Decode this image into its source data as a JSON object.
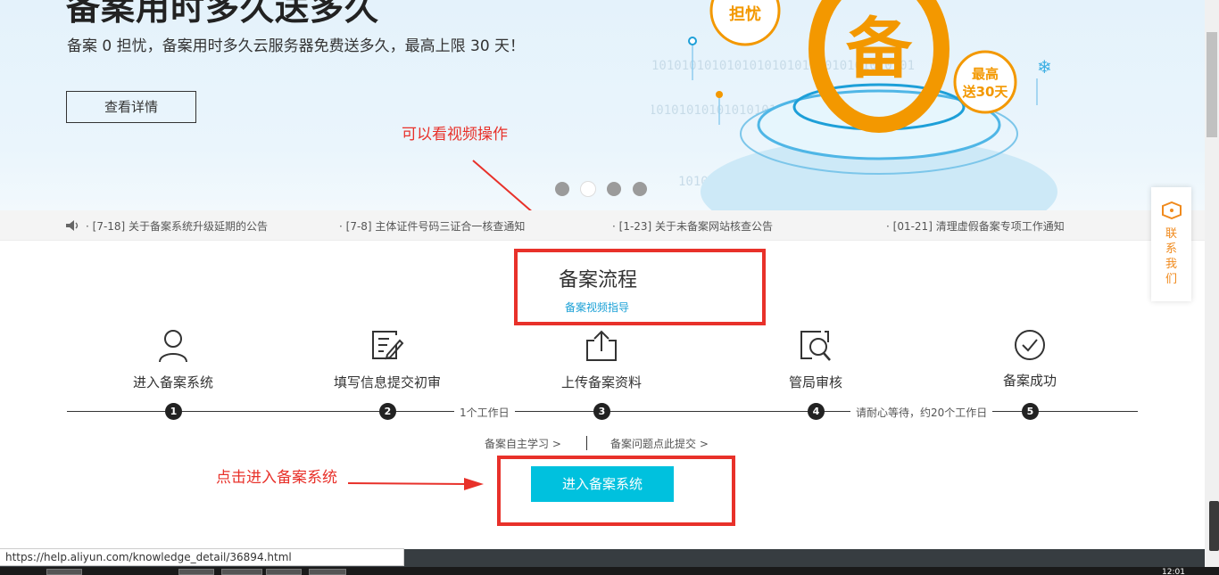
{
  "banner": {
    "title": "备案用时多久送多久",
    "subtitle": "备案 0 担忧，备案用时多久云服务器免费送多久，最高上限 30 天！",
    "detail_button": "查看详情",
    "badge_worry": "担忧",
    "badge_big": "备",
    "badge_max_line1": "最高",
    "badge_max_line2": "送30天",
    "binary_text": "10101010101010101010101010101010101",
    "carousel_active_index": 1,
    "carousel_count": 4
  },
  "annotations": {
    "video_hint": "可以看视频操作",
    "enter_hint": "点击进入备案系统"
  },
  "notices": [
    "[7-18] 关于备案系统升级延期的公告",
    "[7-8] 主体证件号码三证合一核查通知",
    "[1-23] 关于未备案网站核查公告",
    "[01-21] 清理虚假备案专项工作通知"
  ],
  "contact": {
    "label": "联系我们"
  },
  "process": {
    "title": "备案流程",
    "video_link": "备案视频指导",
    "steps": [
      {
        "label": "进入备案系统",
        "num": "1",
        "icon": "user-icon"
      },
      {
        "label": "填写信息提交初审",
        "num": "2",
        "icon": "edit-form-icon"
      },
      {
        "label": "上传备案资料",
        "num": "3",
        "icon": "upload-icon"
      },
      {
        "label": "管局审核",
        "num": "4",
        "icon": "search-review-icon"
      },
      {
        "label": "备案成功",
        "num": "5",
        "icon": "check-circle-icon"
      }
    ],
    "time_notes": [
      "1个工作日",
      "请耐心等待，约20个工作日"
    ],
    "self_study_link": "备案自主学习 >",
    "issue_link": "备案问题点此提交 >",
    "enter_button": "进入备案系统"
  },
  "status_bar": {
    "url": "https://help.aliyun.com/knowledge_detail/36894.html"
  },
  "taskbar": {
    "clock": "12:01"
  },
  "colors": {
    "accent": "#00c1de",
    "annotation_red": "#e8312a",
    "badge_orange": "#f39800",
    "link_blue": "#1aa0d6",
    "contact_orange": "#f08a1d"
  }
}
